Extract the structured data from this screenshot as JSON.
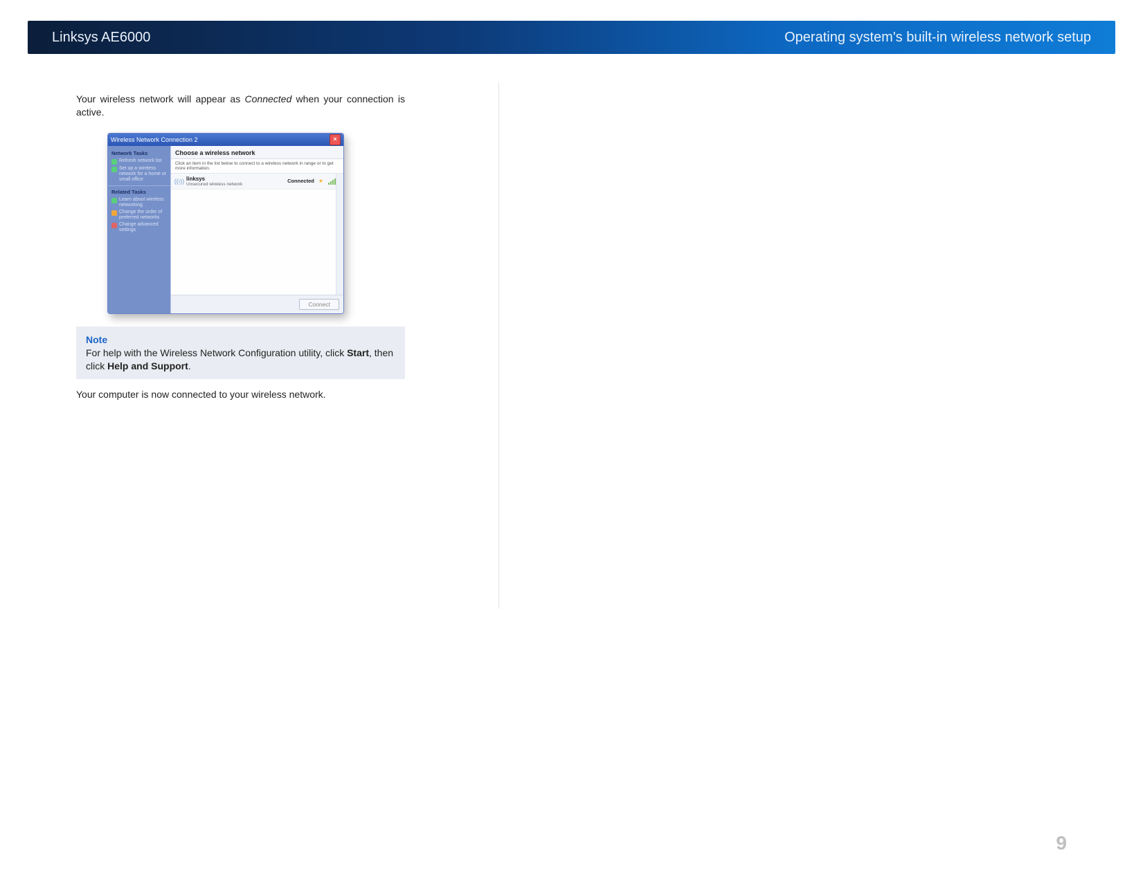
{
  "header": {
    "left": "Linksys AE6000",
    "right": "Operating system's built-in wireless network setup"
  },
  "intro": {
    "before_italic": "Your wireless network will appear as ",
    "italic": "Connected",
    "after_italic": " when your connection is active."
  },
  "dialog": {
    "title": "Wireless Network Connection 2",
    "sidebar": {
      "section1_title": "Network Tasks",
      "task_refresh": "Refresh network list",
      "task_setup": "Set up a wireless network for a home or small office",
      "section2_title": "Related Tasks",
      "task_learn": "Learn about wireless networking",
      "task_order": "Change the order of preferred networks",
      "task_adv": "Change advanced settings"
    },
    "main": {
      "choose": "Choose a wireless network",
      "hint": "Click an item in the list below to connect to a wireless network in range or to get more information.",
      "item": {
        "name": "linksys",
        "sub": "Unsecured wireless network",
        "status": "Connected"
      },
      "connect_btn": "Connect"
    }
  },
  "note": {
    "title": "Note",
    "text_before_start": "For help with the Wireless Network Configuration utility, click ",
    "start": "Start",
    "text_mid": ", then click ",
    "help": "Help and Support",
    "text_end": "."
  },
  "after": "Your computer is now connected to your wireless network.",
  "page_number": "9"
}
